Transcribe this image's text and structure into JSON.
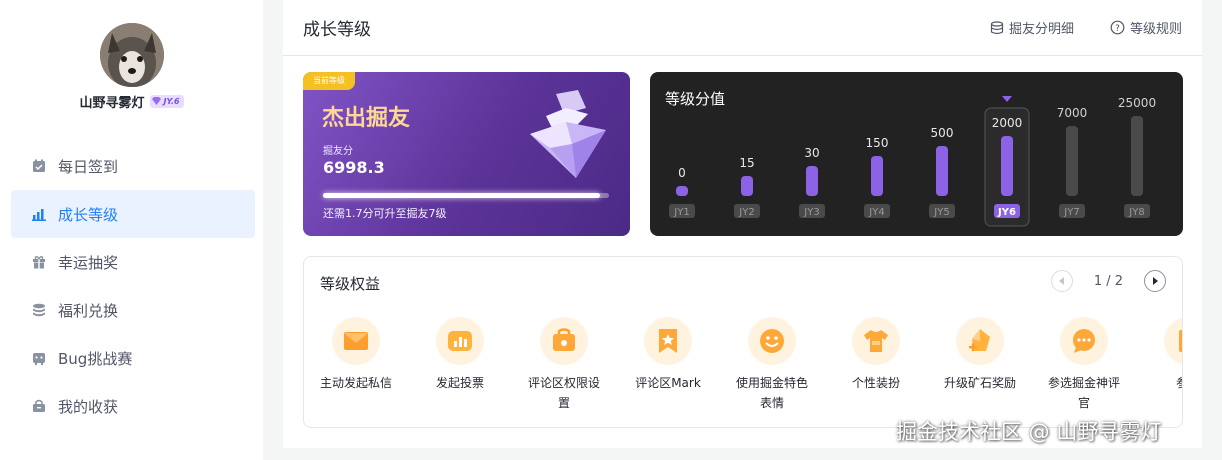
{
  "profile": {
    "name": "山野寻雾灯",
    "level_badge": "JY.6"
  },
  "sidebar": {
    "items": [
      {
        "label": "每日签到",
        "icon": "calendar-check-icon"
      },
      {
        "label": "成长等级",
        "icon": "bar-chart-icon",
        "active": true
      },
      {
        "label": "幸运抽奖",
        "icon": "gift-icon"
      },
      {
        "label": "福利兑换",
        "icon": "coins-stack-icon"
      },
      {
        "label": "Bug挑战赛",
        "icon": "bug-icon"
      },
      {
        "label": "我的收获",
        "icon": "bag-icon"
      }
    ]
  },
  "header": {
    "title": "成长等级",
    "points_detail": "掘友分明细",
    "level_rules": "等级规则"
  },
  "level_card": {
    "tag": "当前等级",
    "level_name": "杰出掘友",
    "points_label": "掘友分",
    "points_value": "6998.3",
    "progress": 0.97,
    "hint": "还需1.7分可升至掘友7级"
  },
  "score_card": {
    "title": "等级分值",
    "current_level": "JY6"
  },
  "chart_data": {
    "type": "bar",
    "title": "等级分值",
    "categories": [
      "JY1",
      "JY2",
      "JY3",
      "JY4",
      "JY5",
      "JY6",
      "JY7",
      "JY8"
    ],
    "values": [
      0,
      15,
      30,
      150,
      500,
      2000,
      7000,
      25000
    ],
    "value_labels": [
      "0",
      "15",
      "30",
      "150",
      "500",
      "2000",
      "7000",
      "25000"
    ],
    "highlight": "JY6",
    "colors": {
      "reached": "#8c63e6",
      "locked": "#4a4a4a",
      "current_label_bg": "#8c63e6"
    }
  },
  "benefits": {
    "title": "等级权益",
    "page": "1 / 2",
    "items": [
      {
        "label": "主动发起私信",
        "icon": "message-envelope-icon"
      },
      {
        "label": "发起投票",
        "icon": "vote-chart-icon"
      },
      {
        "label": "评论区权限设置",
        "icon": "comment-settings-icon"
      },
      {
        "label": "评论区Mark",
        "icon": "bookmark-star-icon"
      },
      {
        "label": "使用掘金特色表情",
        "icon": "smile-face-icon"
      },
      {
        "label": "个性装扮",
        "icon": "tshirt-icon"
      },
      {
        "label": "升级矿石奖励",
        "icon": "ore-plus-icon"
      },
      {
        "label": "参选掘金神评官",
        "icon": "chat-bubble-icon"
      },
      {
        "label": "参选",
        "icon": "document-icon"
      }
    ]
  },
  "watermark": "掘金技术社区 @ 山野寻雾灯"
}
